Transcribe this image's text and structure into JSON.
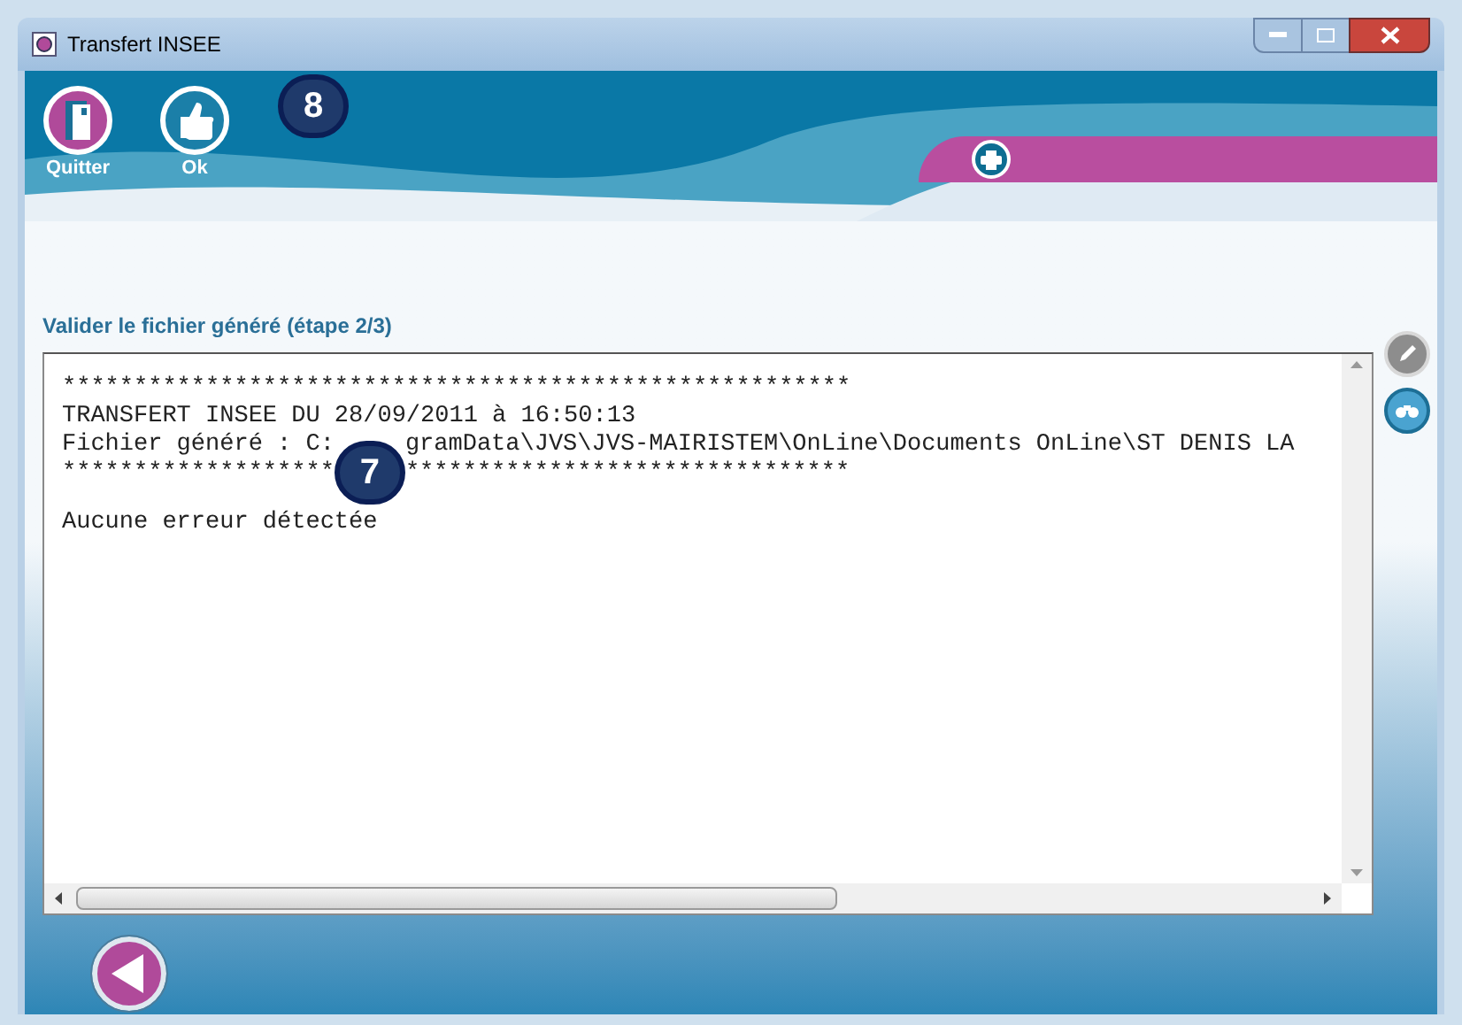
{
  "window": {
    "title": "Transfert INSEE"
  },
  "toolbar": {
    "buttons": [
      {
        "label": "Quitter",
        "kind": "quit"
      },
      {
        "label": "Ok",
        "kind": "ok"
      }
    ],
    "callout": "8"
  },
  "step_title": "Valider le fichier généré (étape 2/3)",
  "log": {
    "callout": "7",
    "paragraphs": [
      [
        {
          "parts": [
            "*******************************************************"
          ]
        },
        {
          "parts": [
            "TRANSFERT INSEE DU 28/09/2011 à 16:50:13"
          ]
        },
        {
          "parts": [
            "Fichier généré : C:",
            "gramData\\JVS\\JVS-MAIRISTEM\\OnLine\\Documents OnLine\\ST DENIS LA"
          ]
        },
        {
          "parts": [
            "*******************",
            "*******************************"
          ]
        }
      ],
      [
        {
          "parts": [
            "Aucune erreur détectée"
          ]
        }
      ]
    ]
  }
}
